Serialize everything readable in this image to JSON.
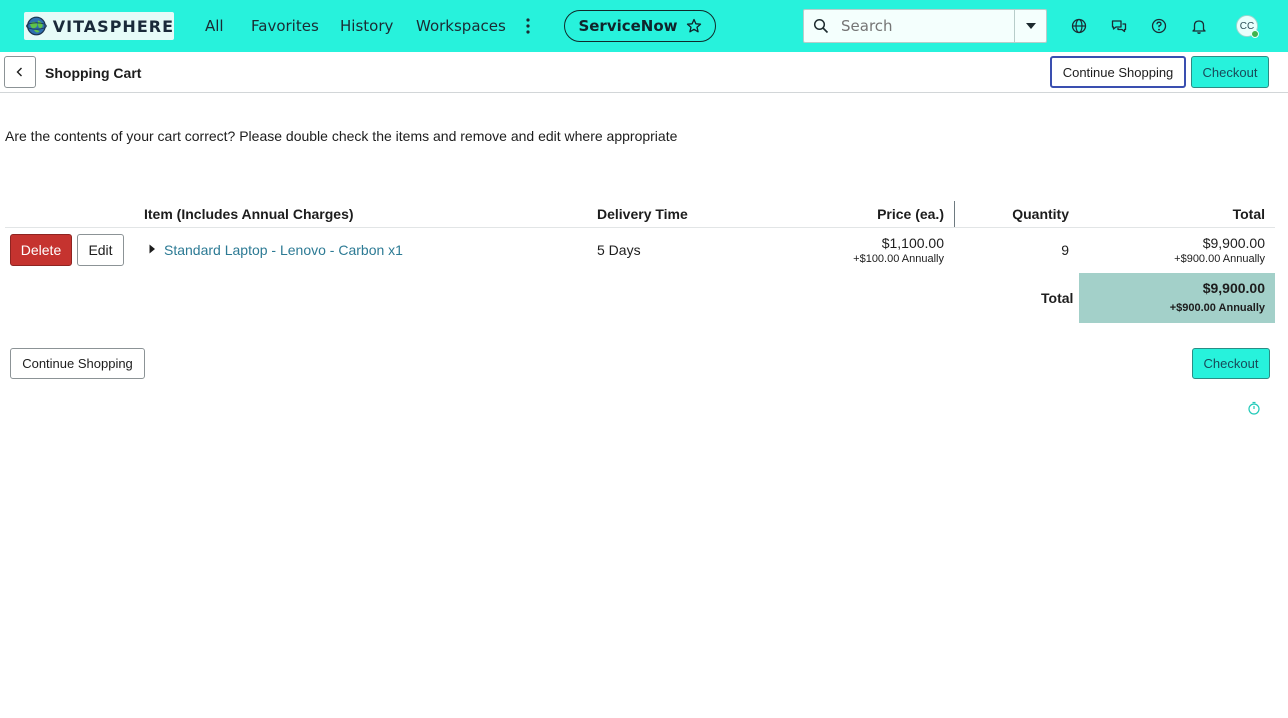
{
  "nav": {
    "logo_text": "VITASPHERE",
    "links": [
      "All",
      "Favorites",
      "History",
      "Workspaces"
    ],
    "app_pill": "ServiceNow",
    "search_placeholder": "Search",
    "avatar_initials": "CC",
    "accent_color": "#27f2dc"
  },
  "header": {
    "title": "Shopping Cart",
    "continue_label": "Continue Shopping",
    "checkout_label": "Checkout"
  },
  "main": {
    "intro": "Are the contents of your cart correct? Please double check the items and remove and edit where appropriate",
    "columns": {
      "item": "Item (Includes Annual Charges)",
      "delivery": "Delivery Time",
      "price": "Price (ea.)",
      "quantity": "Quantity",
      "total": "Total"
    },
    "rows": [
      {
        "delete_label": "Delete",
        "edit_label": "Edit",
        "item": "Standard Laptop - Lenovo - Carbon x1",
        "delivery": "5 Days",
        "price": "$1,100.00",
        "price_annual": "+$100.00 Annually",
        "quantity": "9",
        "total": "$9,900.00",
        "total_annual": "+$900.00 Annually"
      }
    ],
    "grand_total_label": "Total",
    "grand_total": "$9,900.00",
    "grand_total_annual": "+$900.00 Annually"
  },
  "footer": {
    "continue_label": "Continue Shopping",
    "checkout_label": "Checkout"
  }
}
